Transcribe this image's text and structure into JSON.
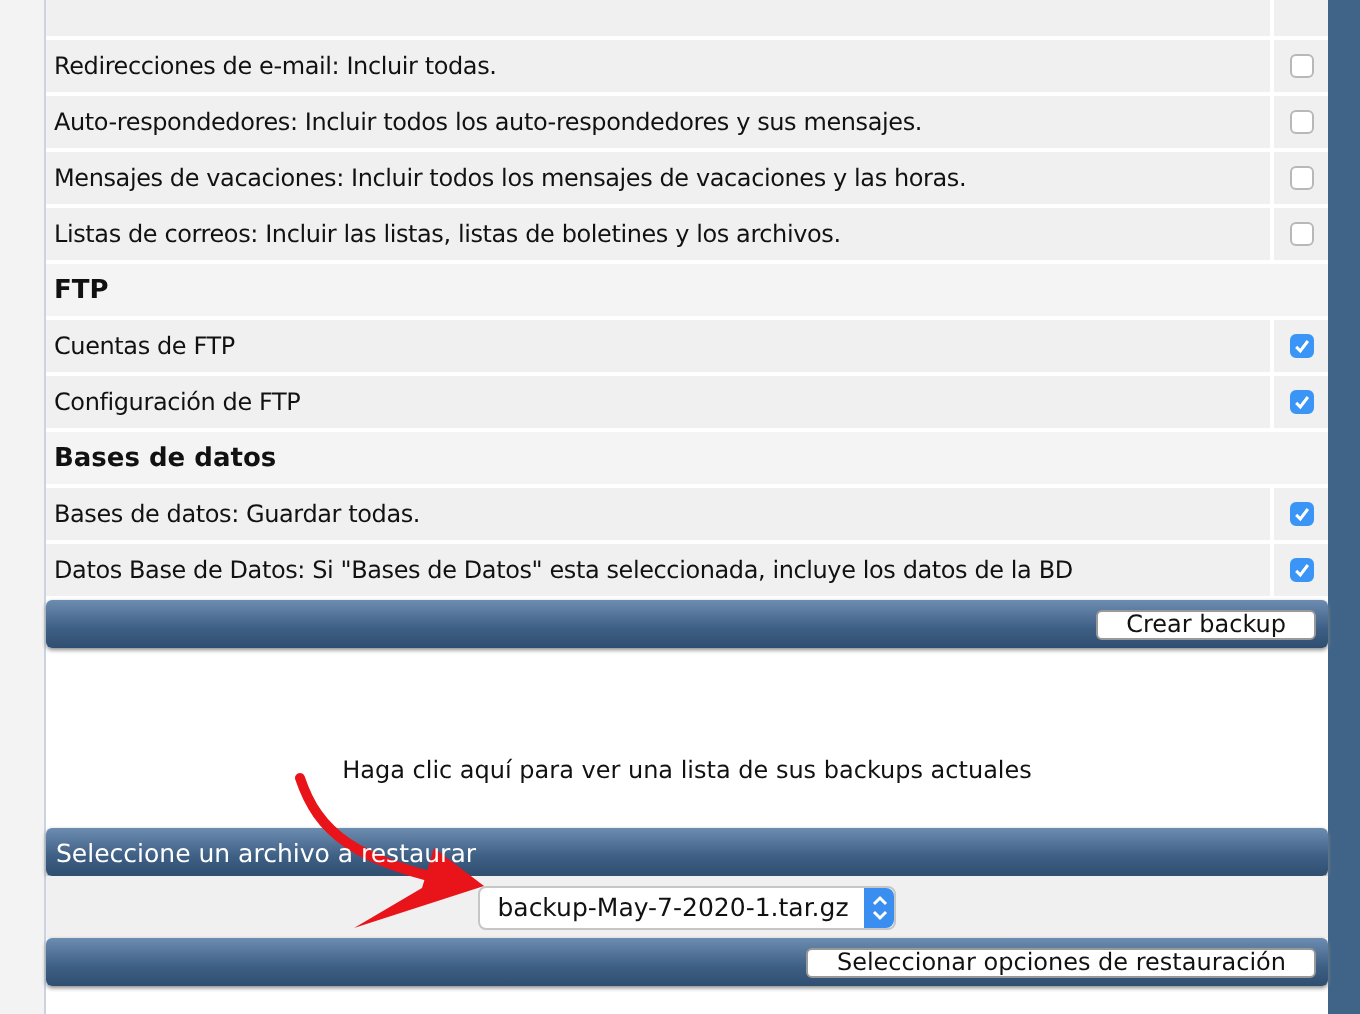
{
  "sections": [
    {
      "rows": [
        {
          "label": "Redirecciones de e-mail: Incluir todas.",
          "checked": false
        },
        {
          "label": "Auto-respondedores: Incluir todos los auto-respondedores y sus mensajes.",
          "checked": false
        },
        {
          "label": "Mensajes de vacaciones: Incluir todos los mensajes de vacaciones y las horas.",
          "checked": false
        },
        {
          "label": "Listas de correos: Incluir las listas, listas de boletines y los archivos.",
          "checked": false
        }
      ]
    },
    {
      "heading": "FTP",
      "rows": [
        {
          "label": "Cuentas de FTP",
          "checked": true
        },
        {
          "label": "Configuración de FTP",
          "checked": true
        }
      ]
    },
    {
      "heading": "Bases de datos",
      "rows": [
        {
          "label": "Bases de datos: Guardar todas.",
          "checked": true
        },
        {
          "label": "Datos Base de Datos: Si \"Bases de Datos\" esta seleccionada, incluye los datos de la BD",
          "checked": true
        }
      ]
    }
  ],
  "create_button": "Crear backup",
  "list_link": "Haga clic aquí para ver una lista de sus backups actuales",
  "restore": {
    "title": "Seleccione un archivo a restaurar",
    "file": "backup-May-7-2020-1.tar.gz",
    "button": "Seleccionar opciones de restauración"
  }
}
